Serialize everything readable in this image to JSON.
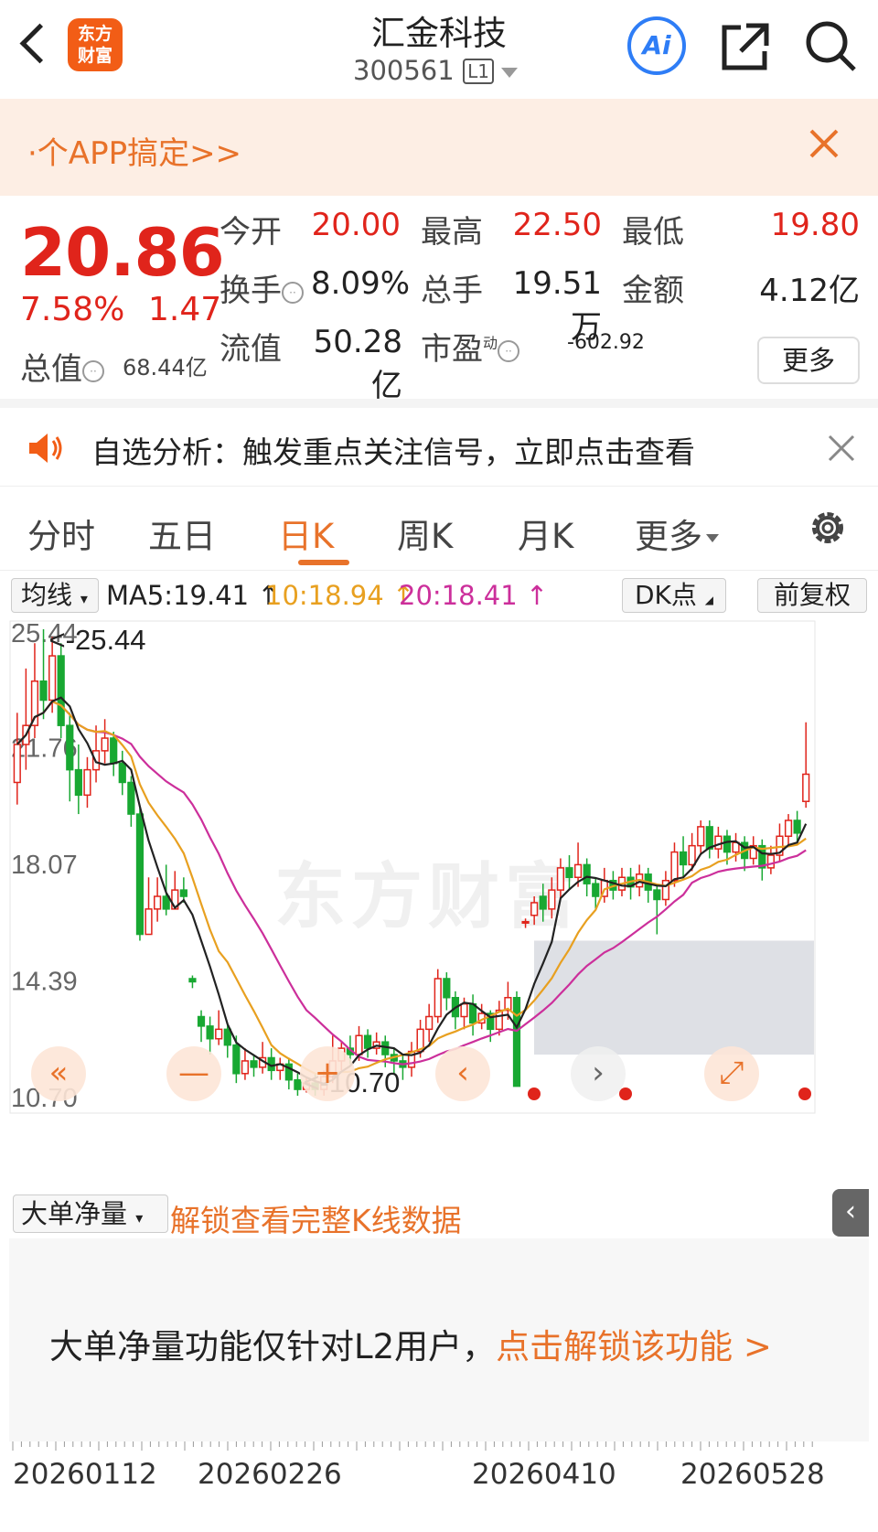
{
  "header": {
    "logo_line1": "东方",
    "logo_line2": "财富",
    "stock_name": "汇金科技",
    "stock_code": "300561",
    "level_badge": "L1",
    "ai_label": "Ai"
  },
  "promo": {
    "text": "·个APP搞定>>"
  },
  "quote": {
    "price": "20.86",
    "change_pct": "7.58%",
    "change_amt": "1.47",
    "open_label": "今开",
    "open": "20.00",
    "high_label": "最高",
    "high": "22.50",
    "low_label": "最低",
    "low": "19.80",
    "turnover_label": "换手",
    "turnover": "8.09%",
    "volume_label": "总手",
    "volume": "19.51万",
    "amount_label": "金额",
    "amount": "4.12亿",
    "total_cap_label": "总值",
    "total_cap": "68.44亿",
    "float_cap_label": "流值",
    "float_cap": "50.28亿",
    "pe_label": "市盈",
    "pe_sup": "动",
    "pe": "-602.92",
    "more_label": "更多"
  },
  "alert": {
    "text": "自选分析：触发重点关注信号，立即点击查看"
  },
  "tabs": [
    {
      "label": "分时"
    },
    {
      "label": "五日"
    },
    {
      "label": "日K"
    },
    {
      "label": "周K"
    },
    {
      "label": "月K"
    },
    {
      "label": "更多"
    }
  ],
  "ma_bar": {
    "select_label": "均线",
    "ma5": "MA5:19.41 ↑",
    "ma10": "10:18.94 ↑",
    "ma20": "20:18.41 ↑",
    "dk_label": "DK点",
    "adjust_label": "前复权",
    "colors": {
      "ma5": "#222222",
      "ma10": "#e8a020",
      "ma20": "#cc2f9b"
    }
  },
  "chart_data": {
    "type": "candlestick",
    "y_ticks": [
      "25.44",
      "21.76",
      "18.07",
      "14.39",
      "10.70"
    ],
    "ylim": [
      10.7,
      25.44
    ],
    "max_annotation": "<-25.44",
    "min_annotation": "<-10.70",
    "watermark": "东方财富",
    "x_labels": [
      "20260112",
      "20260226",
      "20260410",
      "20260528"
    ],
    "up_color": "#e0241b",
    "down_color": "#18a832",
    "candles": [
      {
        "o": 20.6,
        "c": 21.8,
        "h": 22.8,
        "l": 19.9
      },
      {
        "o": 21.8,
        "c": 22.4,
        "h": 24.2,
        "l": 21.0
      },
      {
        "o": 22.4,
        "c": 23.8,
        "h": 25.0,
        "l": 22.0
      },
      {
        "o": 23.8,
        "c": 23.2,
        "h": 25.44,
        "l": 22.6
      },
      {
        "o": 23.2,
        "c": 24.6,
        "h": 25.2,
        "l": 22.8
      },
      {
        "o": 24.6,
        "c": 22.4,
        "h": 25.0,
        "l": 22.0
      },
      {
        "o": 22.4,
        "c": 21.0,
        "h": 22.8,
        "l": 20.0
      },
      {
        "o": 21.0,
        "c": 20.2,
        "h": 21.8,
        "l": 19.6
      },
      {
        "o": 20.2,
        "c": 21.0,
        "h": 21.4,
        "l": 19.8
      },
      {
        "o": 21.0,
        "c": 21.6,
        "h": 22.4,
        "l": 20.6
      },
      {
        "o": 21.6,
        "c": 22.0,
        "h": 22.6,
        "l": 21.2
      },
      {
        "o": 22.0,
        "c": 21.2,
        "h": 22.2,
        "l": 20.8
      },
      {
        "o": 21.2,
        "c": 20.6,
        "h": 21.6,
        "l": 20.2
      },
      {
        "o": 20.6,
        "c": 19.6,
        "h": 20.8,
        "l": 19.2
      },
      {
        "o": 19.6,
        "c": 15.8,
        "h": 19.8,
        "l": 15.6
      },
      {
        "o": 15.8,
        "c": 16.6,
        "h": 17.6,
        "l": 15.9
      },
      {
        "o": 16.6,
        "c": 17.0,
        "h": 17.6,
        "l": 16.2
      },
      {
        "o": 17.0,
        "c": 16.6,
        "h": 18.0,
        "l": 16.4
      },
      {
        "o": 16.6,
        "c": 17.2,
        "h": 17.8,
        "l": 16.6
      },
      {
        "o": 17.2,
        "c": 17.0,
        "h": 17.6,
        "l": 16.8
      },
      {
        "o": 14.4,
        "c": 14.3,
        "h": 14.5,
        "l": 14.1
      },
      {
        "o": 13.2,
        "c": 12.9,
        "h": 13.4,
        "l": 12.4
      },
      {
        "o": 12.9,
        "c": 12.5,
        "h": 13.2,
        "l": 12.0
      },
      {
        "o": 12.5,
        "c": 12.8,
        "h": 13.4,
        "l": 12.3
      },
      {
        "o": 12.8,
        "c": 12.3,
        "h": 13.0,
        "l": 11.9
      },
      {
        "o": 12.3,
        "c": 11.4,
        "h": 12.6,
        "l": 11.1
      },
      {
        "o": 11.4,
        "c": 11.8,
        "h": 12.2,
        "l": 11.2
      },
      {
        "o": 11.8,
        "c": 11.6,
        "h": 12.0,
        "l": 11.3
      },
      {
        "o": 11.6,
        "c": 11.9,
        "h": 12.4,
        "l": 11.4
      },
      {
        "o": 11.9,
        "c": 11.5,
        "h": 12.2,
        "l": 11.2
      },
      {
        "o": 11.5,
        "c": 11.7,
        "h": 11.9,
        "l": 11.2
      },
      {
        "o": 11.7,
        "c": 11.2,
        "h": 11.9,
        "l": 10.9
      },
      {
        "o": 11.2,
        "c": 10.9,
        "h": 11.4,
        "l": 10.7
      },
      {
        "o": 10.9,
        "c": 11.1,
        "h": 11.3,
        "l": 10.8
      },
      {
        "o": 11.1,
        "c": 10.9,
        "h": 11.4,
        "l": 10.7
      },
      {
        "o": 10.9,
        "c": 11.3,
        "h": 11.5,
        "l": 10.7
      },
      {
        "o": 11.3,
        "c": 11.8,
        "h": 12.6,
        "l": 11.1
      },
      {
        "o": 11.8,
        "c": 12.2,
        "h": 12.4,
        "l": 11.5
      },
      {
        "o": 12.2,
        "c": 12.0,
        "h": 12.6,
        "l": 11.7
      },
      {
        "o": 12.0,
        "c": 12.6,
        "h": 12.9,
        "l": 11.8
      },
      {
        "o": 12.6,
        "c": 12.2,
        "h": 12.8,
        "l": 11.9
      },
      {
        "o": 12.2,
        "c": 12.4,
        "h": 12.7,
        "l": 12.0
      },
      {
        "o": 12.4,
        "c": 12.0,
        "h": 12.6,
        "l": 11.6
      },
      {
        "o": 12.0,
        "c": 11.8,
        "h": 12.2,
        "l": 11.4
      },
      {
        "o": 11.8,
        "c": 11.6,
        "h": 12.0,
        "l": 11.2
      },
      {
        "o": 11.6,
        "c": 12.1,
        "h": 12.4,
        "l": 11.3
      },
      {
        "o": 12.1,
        "c": 12.8,
        "h": 13.1,
        "l": 11.9
      },
      {
        "o": 12.8,
        "c": 13.2,
        "h": 13.6,
        "l": 12.4
      },
      {
        "o": 13.2,
        "c": 14.4,
        "h": 14.7,
        "l": 13.0
      },
      {
        "o": 14.4,
        "c": 13.8,
        "h": 14.6,
        "l": 13.4
      },
      {
        "o": 13.8,
        "c": 13.2,
        "h": 14.0,
        "l": 12.8
      },
      {
        "o": 13.2,
        "c": 13.6,
        "h": 13.8,
        "l": 12.8
      },
      {
        "o": 13.6,
        "c": 13.0,
        "h": 13.9,
        "l": 12.6
      },
      {
        "o": 13.0,
        "c": 13.3,
        "h": 13.6,
        "l": 12.8
      },
      {
        "o": 13.3,
        "c": 12.8,
        "h": 13.4,
        "l": 12.4
      },
      {
        "o": 12.8,
        "c": 13.4,
        "h": 13.7,
        "l": 12.6
      },
      {
        "o": 13.4,
        "c": 13.8,
        "h": 14.3,
        "l": 13.1
      },
      {
        "o": 13.8,
        "c": 11.0,
        "h": 14.0,
        "l": 11.0
      },
      {
        "o": 16.2,
        "c": 16.2,
        "h": 16.3,
        "l": 16.0
      },
      {
        "o": 16.4,
        "c": 16.8,
        "h": 17.0,
        "l": 16.1
      },
      {
        "o": 17.0,
        "c": 16.6,
        "h": 17.4,
        "l": 16.2
      },
      {
        "o": 16.6,
        "c": 17.2,
        "h": 17.6,
        "l": 16.3
      },
      {
        "o": 17.2,
        "c": 17.9,
        "h": 18.2,
        "l": 16.9
      },
      {
        "o": 17.9,
        "c": 17.6,
        "h": 18.3,
        "l": 17.2
      },
      {
        "o": 17.6,
        "c": 18.0,
        "h": 18.7,
        "l": 17.3
      },
      {
        "o": 18.0,
        "c": 17.4,
        "h": 18.2,
        "l": 17.0
      },
      {
        "o": 17.4,
        "c": 17.0,
        "h": 17.6,
        "l": 16.6
      },
      {
        "o": 17.0,
        "c": 17.5,
        "h": 17.9,
        "l": 16.8
      },
      {
        "o": 17.5,
        "c": 17.2,
        "h": 17.8,
        "l": 16.9
      },
      {
        "o": 17.2,
        "c": 17.6,
        "h": 17.9,
        "l": 17.0
      },
      {
        "o": 17.6,
        "c": 17.3,
        "h": 17.9,
        "l": 16.9
      },
      {
        "o": 17.3,
        "c": 17.7,
        "h": 18.0,
        "l": 17.0
      },
      {
        "o": 17.7,
        "c": 17.2,
        "h": 17.9,
        "l": 16.8
      },
      {
        "o": 17.2,
        "c": 16.9,
        "h": 17.4,
        "l": 15.8
      },
      {
        "o": 16.9,
        "c": 17.5,
        "h": 17.8,
        "l": 16.7
      },
      {
        "o": 17.5,
        "c": 18.4,
        "h": 18.7,
        "l": 17.3
      },
      {
        "o": 18.4,
        "c": 18.0,
        "h": 18.9,
        "l": 17.6
      },
      {
        "o": 18.0,
        "c": 18.6,
        "h": 19.0,
        "l": 17.8
      },
      {
        "o": 18.6,
        "c": 19.2,
        "h": 19.4,
        "l": 18.3
      },
      {
        "o": 19.2,
        "c": 18.5,
        "h": 19.4,
        "l": 18.2
      },
      {
        "o": 18.5,
        "c": 18.9,
        "h": 19.2,
        "l": 18.2
      },
      {
        "o": 18.9,
        "c": 18.4,
        "h": 19.1,
        "l": 18.0
      },
      {
        "o": 18.4,
        "c": 18.7,
        "h": 19.0,
        "l": 18.1
      },
      {
        "o": 18.7,
        "c": 18.2,
        "h": 18.9,
        "l": 17.8
      },
      {
        "o": 18.2,
        "c": 18.6,
        "h": 18.9,
        "l": 18.0
      },
      {
        "o": 18.6,
        "c": 17.9,
        "h": 18.8,
        "l": 17.5
      },
      {
        "o": 17.9,
        "c": 18.3,
        "h": 18.6,
        "l": 17.7
      },
      {
        "o": 18.3,
        "c": 18.9,
        "h": 19.3,
        "l": 18.1
      },
      {
        "o": 18.9,
        "c": 19.4,
        "h": 19.6,
        "l": 18.6
      },
      {
        "o": 19.4,
        "c": 19.0,
        "h": 19.7,
        "l": 18.7
      },
      {
        "o": 20.0,
        "c": 20.86,
        "h": 22.5,
        "l": 19.8
      }
    ]
  },
  "volume": {
    "select_label": "大单净量",
    "unlock_text": "解锁查看完整K线数据",
    "message": "大单净量功能仅针对L2用户，",
    "message_link": "点击解锁该功能 >"
  }
}
